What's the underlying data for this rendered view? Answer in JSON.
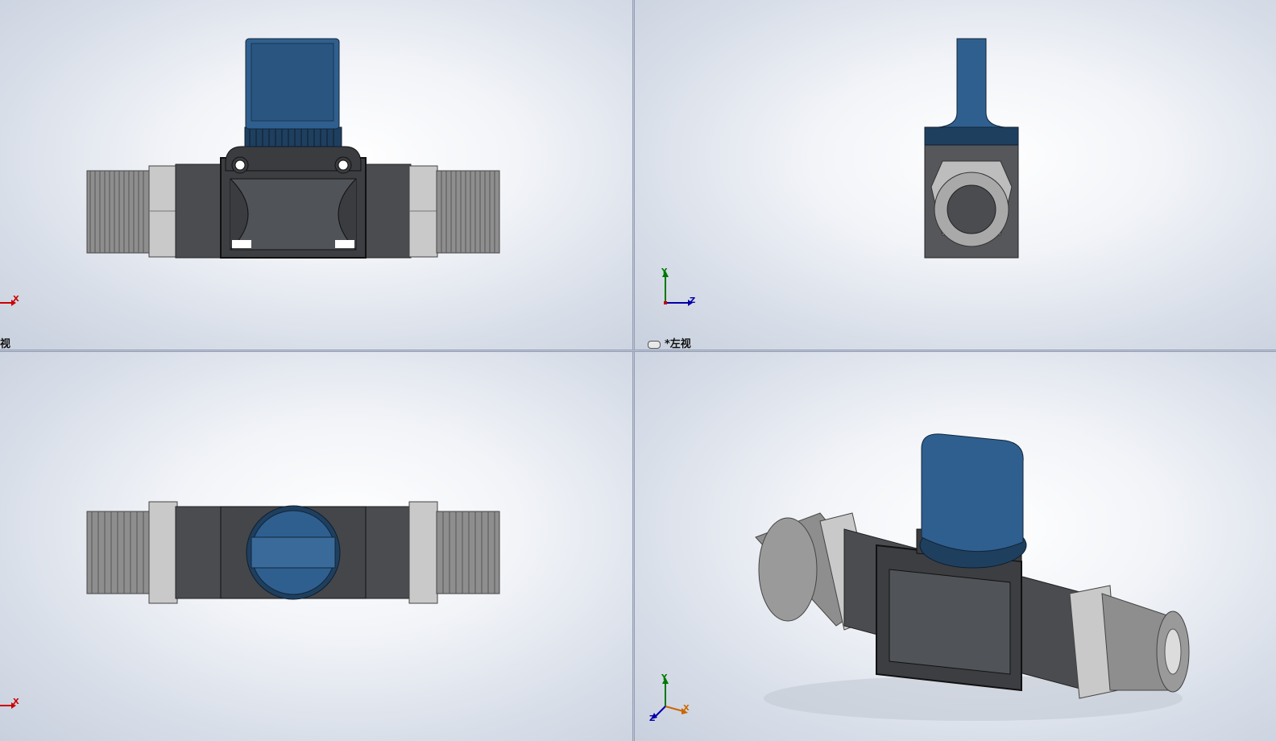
{
  "viewports": {
    "front": {
      "label": "视"
    },
    "left": {
      "label": "*左视"
    },
    "top": {
      "label": ""
    },
    "iso": {
      "label": ""
    }
  },
  "axes": {
    "x": "X",
    "y": "Y",
    "z": "Z"
  },
  "colors": {
    "handle_blue": "#2f5f8f",
    "body_dark": "#4a4c50",
    "thread_gray": "#9a9a9a",
    "hex_light": "#cfcfcf"
  }
}
